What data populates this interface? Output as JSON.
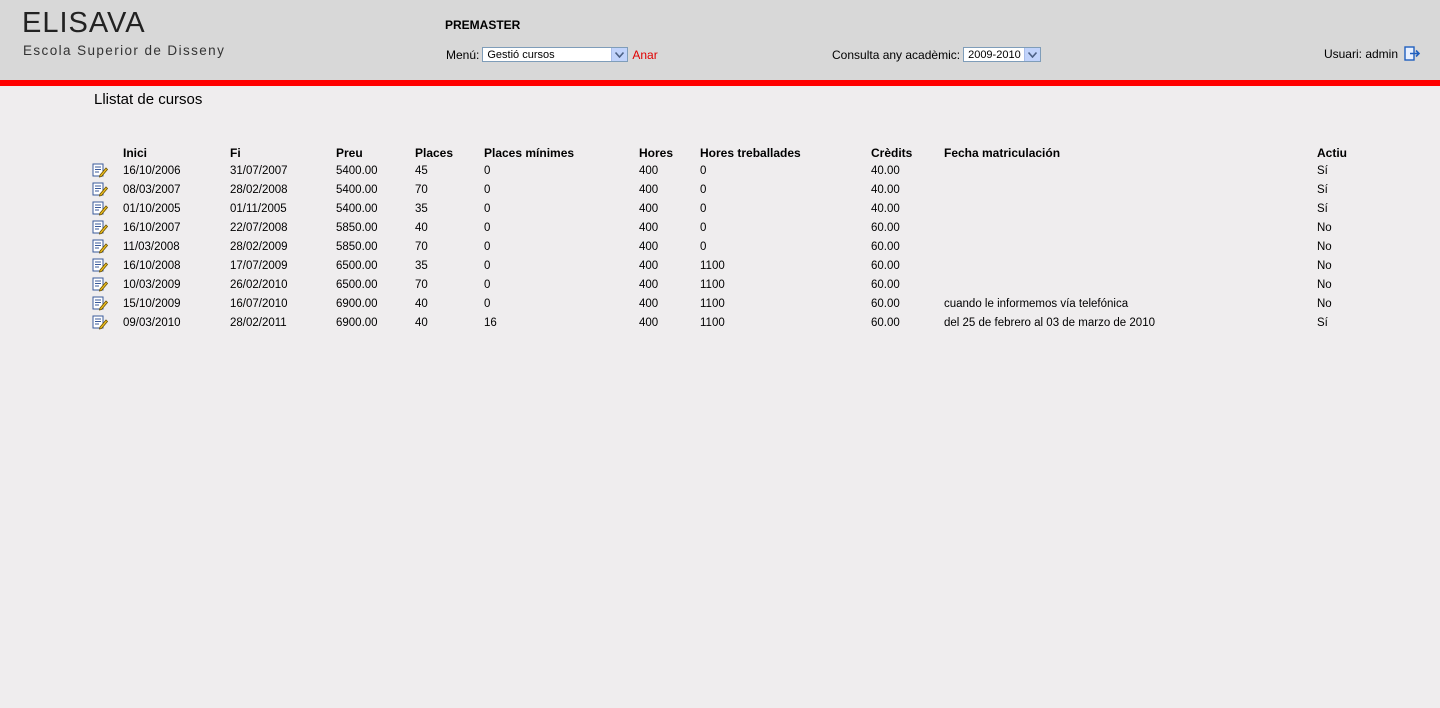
{
  "header": {
    "logo_title": "ELISAVA",
    "logo_subtitle": "Escola Superior de Disseny",
    "app_name": "PREMASTER",
    "menu_label": "Menú:",
    "menu_selected": "Gestió cursos",
    "go_label": "Anar",
    "year_label": "Consulta any acadèmic:",
    "year_selected": "2009-2010",
    "user_label": "Usuari: admin"
  },
  "page_title": "Llistat de cursos",
  "columns": [
    "Inici",
    "Fi",
    "Preu",
    "Places",
    "Places mínimes",
    "Hores",
    "Hores treballades",
    "Crèdits",
    "Fecha matriculación",
    "Actiu"
  ],
  "rows": [
    [
      "16/10/2006",
      "31/07/2007",
      "5400.00",
      "45",
      "0",
      "400",
      "0",
      "40.00",
      "",
      "Sí"
    ],
    [
      "08/03/2007",
      "28/02/2008",
      "5400.00",
      "70",
      "0",
      "400",
      "0",
      "40.00",
      "",
      "Sí"
    ],
    [
      "01/10/2005",
      "01/11/2005",
      "5400.00",
      "35",
      "0",
      "400",
      "0",
      "40.00",
      "",
      "Sí"
    ],
    [
      "16/10/2007",
      "22/07/2008",
      "5850.00",
      "40",
      "0",
      "400",
      "0",
      "60.00",
      "",
      "No"
    ],
    [
      "11/03/2008",
      "28/02/2009",
      "5850.00",
      "70",
      "0",
      "400",
      "0",
      "60.00",
      "",
      "No"
    ],
    [
      "16/10/2008",
      "17/07/2009",
      "6500.00",
      "35",
      "0",
      "400",
      "1100",
      "60.00",
      "",
      "No"
    ],
    [
      "10/03/2009",
      "26/02/2010",
      "6500.00",
      "70",
      "0",
      "400",
      "1100",
      "60.00",
      "",
      "No"
    ],
    [
      "15/10/2009",
      "16/07/2010",
      "6900.00",
      "40",
      "0",
      "400",
      "1100",
      "60.00",
      "cuando le informemos vía telefónica",
      "No"
    ],
    [
      "09/03/2010",
      "28/02/2011",
      "6900.00",
      "40",
      "16",
      "400",
      "1100",
      "60.00",
      "del 25 de febrero al 03 de marzo de 2010",
      "Sí"
    ]
  ],
  "icons": {
    "edit": "edit-document-icon",
    "logout": "logout-icon",
    "dropdown": "chevron-down-icon"
  },
  "colors": {
    "header_bg": "#d8d8d8",
    "accent_red": "#ff0000",
    "link_red": "#e00000",
    "page_bg": "#efedee"
  }
}
